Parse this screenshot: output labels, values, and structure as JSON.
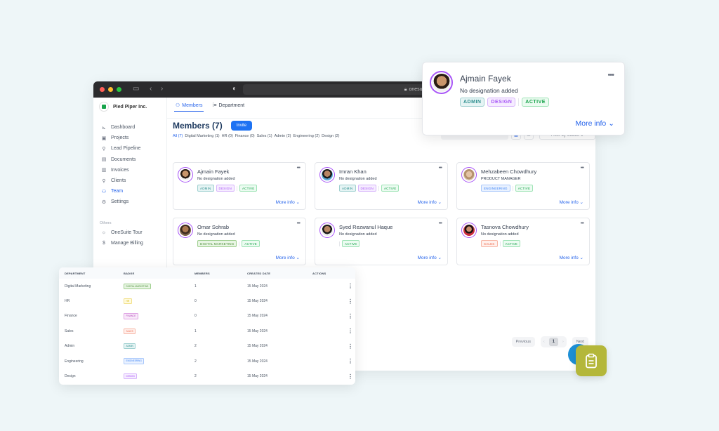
{
  "browser": {
    "url": "onesuite.io"
  },
  "sidebar": {
    "brand": "Pied Piper Inc.",
    "items": [
      {
        "label": "Dashboard",
        "icon": "chart-icon"
      },
      {
        "label": "Projects",
        "icon": "projects-icon"
      },
      {
        "label": "Lead Pipeline",
        "icon": "user-plus-icon"
      },
      {
        "label": "Documents",
        "icon": "document-icon"
      },
      {
        "label": "Invoices",
        "icon": "invoice-icon"
      },
      {
        "label": "Clients",
        "icon": "user-icon"
      },
      {
        "label": "Team",
        "icon": "team-icon",
        "active": true
      },
      {
        "label": "Settings",
        "icon": "gear-icon"
      }
    ],
    "others_label": "Others",
    "others": [
      {
        "label": "OneSuite Tour",
        "icon": "sun-icon"
      },
      {
        "label": "Manage Billing",
        "icon": "dollar-icon"
      }
    ]
  },
  "main": {
    "tabs": [
      {
        "label": "Members",
        "active": true
      },
      {
        "label": "Department"
      }
    ],
    "title": "Members (7)",
    "invite_label": "Invite",
    "filters": [
      "All (7)",
      "Digital Marketing (1)",
      "HR (0)",
      "Finance (0)",
      "Sales (1)",
      "Admin (2)",
      "Engineering (2)",
      "Design (2)"
    ],
    "search_placeholder": "Search...",
    "filter_status_label": "Filter by Status",
    "more_info_label": "More info",
    "members": [
      {
        "name": "Ajmain Fayek",
        "designation": "No designation added",
        "badges": [
          "ADMIN",
          "DESIGN"
        ],
        "status": "ACTIVE"
      },
      {
        "name": "Imran Khan",
        "designation": "No designation added",
        "badges": [
          "ADMIN",
          "DESIGN"
        ],
        "status": "ACTIVE"
      },
      {
        "name": "Mehzabeen Chowdhury",
        "designation": "PRODUCT MANAGER",
        "badges": [
          "ENGINEERING"
        ],
        "status": "ACTIVE"
      },
      {
        "name": "Omar Sohrab",
        "designation": "No designation added",
        "badges": [
          "DIGITAL MARKETING"
        ],
        "status": "ACTIVE"
      },
      {
        "name": "Syed Rezwanul Haque",
        "designation": "No designation added",
        "badges": [],
        "status": "ACTIVE"
      },
      {
        "name": "Tasnova Chowdhury",
        "designation": "No designation added",
        "badges": [
          "SALES"
        ],
        "status": "ACTIVE"
      }
    ],
    "pagination": {
      "previous": "Previous",
      "next": "Next",
      "current": "1"
    }
  },
  "profile_popup": {
    "name": "Ajmain Fayek",
    "designation": "No designation added",
    "badges": [
      "ADMIN",
      "DESIGN"
    ],
    "status": "ACTIVE",
    "more_info": "More info"
  },
  "department_table": {
    "headers": [
      "DEPARTMENT",
      "BADGE",
      "MEMBERS",
      "CREATED DATE",
      "ACTIONS"
    ],
    "rows": [
      {
        "department": "Digital Marketing",
        "badge": "DIGITAL MARKETING",
        "members": "1",
        "created": "15 May 2024"
      },
      {
        "department": "HR",
        "badge": "HR",
        "members": "0",
        "created": "15 May 2024"
      },
      {
        "department": "Finance",
        "badge": "FINANCE",
        "members": "0",
        "created": "15 May 2024"
      },
      {
        "department": "Sales",
        "badge": "SALES",
        "members": "1",
        "created": "15 May 2024"
      },
      {
        "department": "Admin",
        "badge": "ADMIN",
        "members": "2",
        "created": "15 May 2024"
      },
      {
        "department": "Engineering",
        "badge": "ENGINEERING",
        "members": "2",
        "created": "15 May 2024"
      },
      {
        "department": "Design",
        "badge": "DESIGN",
        "members": "2",
        "created": "15 May 2024"
      }
    ]
  },
  "badge_colors": {
    "ADMIN": {
      "fg": "#2f8f8f",
      "bg": "#e6f4f4",
      "border": "#9fd0d0"
    },
    "DESIGN": {
      "fg": "#a855f7",
      "bg": "#f6edff",
      "border": "#d7b4fb"
    },
    "ACTIVE": {
      "fg": "#16a34a",
      "bg": "#ecfbf1",
      "border": "#9ee3b5"
    },
    "ENGINEERING": {
      "fg": "#3b82f6",
      "bg": "#eaf2ff",
      "border": "#a9c8fb"
    },
    "DIGITAL MARKETING": {
      "fg": "#4d8f3a",
      "bg": "#e8f5e3",
      "border": "#9fcf8f"
    },
    "SALES": {
      "fg": "#ef6a4d",
      "bg": "#fff0ec",
      "border": "#f7b6a6"
    },
    "HR": {
      "fg": "#d9b400",
      "bg": "#fffbe0",
      "border": "#f2e08a"
    },
    "FINANCE": {
      "fg": "#b142b8",
      "bg": "#f9eafa",
      "border": "#dfa2e3"
    }
  },
  "colors": {
    "accent": "#2563eb",
    "fab_green": "#b4b73a",
    "fab_blue": "#1e90d6"
  }
}
